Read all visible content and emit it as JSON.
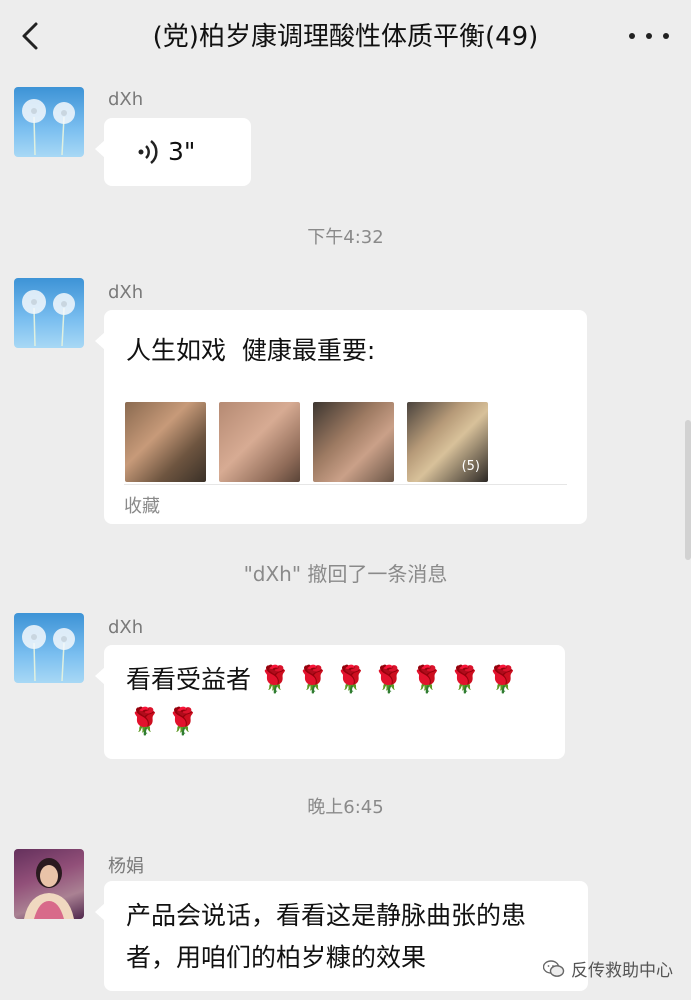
{
  "header": {
    "title": "(党)柏岁康调理酸性体质平衡(49)",
    "back_icon": "chevron-left-icon",
    "more_icon": "more-dots-icon"
  },
  "messages": [
    {
      "sender": "dXh",
      "avatar": "dandelion-avatar",
      "type": "voice",
      "duration": "3\""
    },
    {
      "type": "timestamp",
      "text": "下午4:32"
    },
    {
      "sender": "dXh",
      "avatar": "dandelion-avatar",
      "type": "favorite-card",
      "text": "人生如戏  健康最重要:",
      "image_count": "(5)",
      "footer": "收藏"
    },
    {
      "type": "system",
      "text": "\"dXh\" 撤回了一条消息"
    },
    {
      "sender": "dXh",
      "avatar": "dandelion-avatar",
      "type": "text",
      "text": "看看受益者",
      "emoji_count": 9,
      "emoji": "🌹"
    },
    {
      "type": "timestamp",
      "text": "晚上6:45"
    },
    {
      "sender": "杨娟",
      "avatar": "woman-avatar",
      "type": "text",
      "text": "产品会说话，看看这是静脉曲张的患者，用咱们的柏岁糠的效果"
    }
  ],
  "watermark": {
    "text": "反传救助中心",
    "icon": "wechat-icon"
  },
  "colors": {
    "background": "#ededed",
    "bubble": "#ffffff",
    "meta_text": "#8a8a8a"
  }
}
